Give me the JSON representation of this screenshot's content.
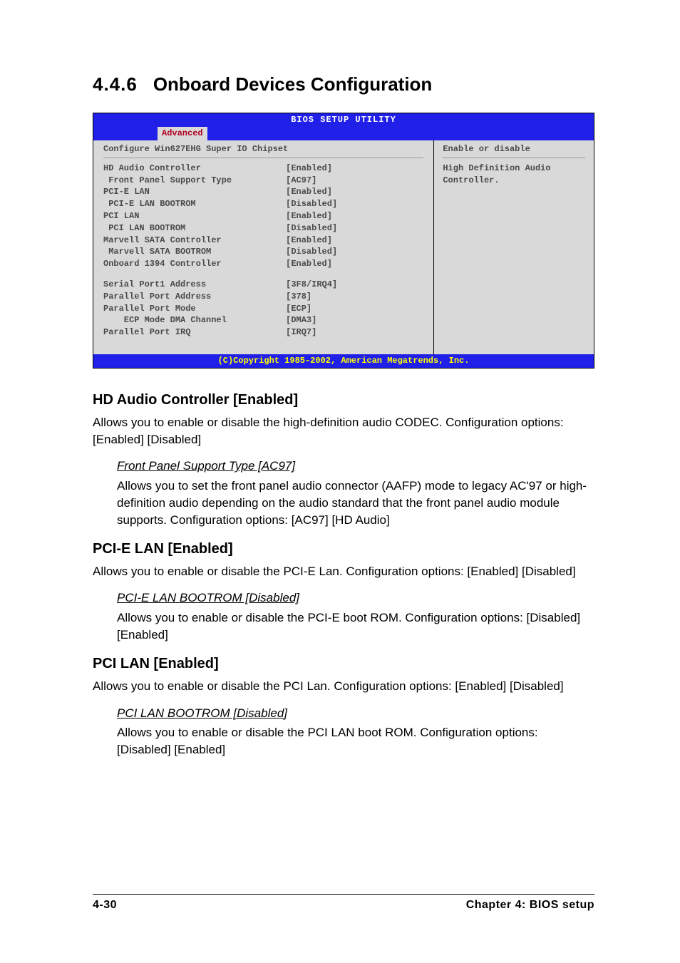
{
  "heading": {
    "number": "4.4.6",
    "title": "Onboard Devices Configuration"
  },
  "bios": {
    "utility_title": "BIOS SETUP UTILITY",
    "active_tab": "Advanced",
    "left_header": "Configure Win627EHG Super IO Chipset",
    "right_header": "Enable or disable",
    "help_text": "High Definition Audio Controller.",
    "group1": [
      {
        "label": "HD Audio Controller",
        "value": "[Enabled]",
        "indent": 0
      },
      {
        "label": "Front Panel Support Type",
        "value": "[AC97]",
        "indent": 1
      },
      {
        "label": "PCI-E LAN",
        "value": "[Enabled]",
        "indent": 0
      },
      {
        "label": "PCI-E LAN BOOTROM",
        "value": "[Disabled]",
        "indent": 1
      },
      {
        "label": "PCI LAN",
        "value": "[Enabled]",
        "indent": 0
      },
      {
        "label": "PCI LAN BOOTROM",
        "value": "[Disabled]",
        "indent": 1
      },
      {
        "label": "Marvell SATA Controller",
        "value": "[Enabled]",
        "indent": 0
      },
      {
        "label": "Marvell SATA BOOTROM",
        "value": "[Disabled]",
        "indent": 1
      },
      {
        "label": "Onboard 1394 Controller",
        "value": "[Enabled]",
        "indent": 0
      }
    ],
    "group2": [
      {
        "label": "Serial Port1 Address",
        "value": "[3F8/IRQ4]",
        "indent": 0
      },
      {
        "label": "Parallel Port Address",
        "value": "[378]",
        "indent": 0
      },
      {
        "label": "Parallel Port Mode",
        "value": "[ECP]",
        "indent": 0
      },
      {
        "label": "ECP Mode DMA Channel",
        "value": "[DMA3]",
        "indent": 2
      },
      {
        "label": "Parallel Port IRQ",
        "value": "[IRQ7]",
        "indent": 0
      }
    ],
    "copyright": "(C)Copyright 1985-2002, American Megatrends, Inc."
  },
  "sections": [
    {
      "title": "HD Audio Controller [Enabled]",
      "body": "Allows you to enable or disable the high-definition audio CODEC. Configuration options: [Enabled] [Disabled]",
      "sub": {
        "title": "Front Panel Support Type [AC97]",
        "body": "Allows you to set the front panel audio connector (AAFP) mode to legacy AC'97 or high-definition audio depending on the audio standard that the front panel audio module supports. Configuration options: [AC97] [HD Audio]"
      }
    },
    {
      "title": "PCI-E LAN [Enabled]",
      "body": "Allows you to enable or disable the PCI-E Lan. Configuration options: [Enabled] [Disabled]",
      "sub": {
        "title": "PCI-E LAN BOOTROM [Disabled]",
        "body": "Allows you to enable or disable the PCI-E boot ROM. Configuration options: [Disabled] [Enabled]"
      }
    },
    {
      "title": "PCI LAN [Enabled]",
      "body": "Allows you to enable or disable the PCI Lan. Configuration options: [Enabled] [Disabled]",
      "sub": {
        "title": "PCI LAN BOOTROM [Disabled]",
        "body": "Allows you to enable or disable the PCI LAN boot ROM. Configuration options: [Disabled] [Enabled]"
      }
    }
  ],
  "footer": {
    "page": "4-30",
    "chapter": "Chapter 4: BIOS setup"
  }
}
